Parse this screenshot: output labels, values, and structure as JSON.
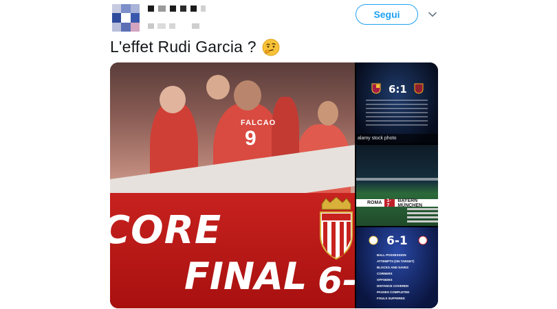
{
  "header": {
    "follow_label": "Segui"
  },
  "tweet": {
    "text": "L'effet Rudi Garcia ?",
    "emoji_icon": "thinking-face-icon"
  },
  "media": {
    "main_image": {
      "banner_word_1": "CORE",
      "banner_word_2": "FINAL",
      "score": "6-",
      "jersey_name": "FALCAO",
      "jersey_number": "9"
    },
    "side_image_1": {
      "score": "6:1",
      "watermark": "alamy stock photo"
    },
    "side_image_2": {
      "home": "ROMA",
      "score": "1-7",
      "away": "BAYERN MÜNCHEN"
    },
    "side_image_3": {
      "score": "6-1",
      "stat_labels": [
        "BALL POSSESSION",
        "ATTEMPTS (ON TARGET)",
        "BLOCKS AND SAVES",
        "CORNERS",
        "OFFSIDES",
        "DISTANCE COVERED",
        "PASSES COMPLETED",
        "FOULS SUFFERED"
      ]
    }
  },
  "colors": {
    "accent": "#1da1f2",
    "text": "#14171a"
  }
}
